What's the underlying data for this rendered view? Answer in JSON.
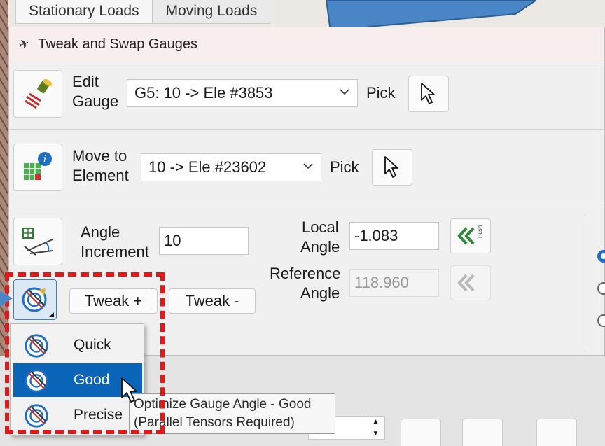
{
  "background": {
    "tabs": [
      "Stationary Loads",
      "Moving Loads"
    ]
  },
  "dialog": {
    "title": "Tweak and Swap Gauges",
    "edit_gauge": {
      "label_line1": "Edit",
      "label_line2": "Gauge",
      "value": "G5: 10 -> Ele #3853",
      "pick_label": "Pick"
    },
    "move_to_element": {
      "label_line1": "Move to",
      "label_line2": "Element",
      "value": "10 -> Ele #23602",
      "pick_label": "Pick"
    },
    "angle": {
      "increment_label_line1": "Angle",
      "increment_label_line2": "Increment",
      "increment_value": "10",
      "local_label_line1": "Local",
      "local_label_line2": "Angle",
      "local_value": "-1.083",
      "reference_label_line1": "Reference",
      "reference_label_line2": "Angle",
      "reference_value": "118.960",
      "push_text": "Push"
    },
    "tweak_plus_label": "Tweak +",
    "tweak_minus_label": "Tweak -"
  },
  "optimize_menu": {
    "items": [
      {
        "label": "Quick"
      },
      {
        "label": "Good"
      },
      {
        "label": "Precise"
      }
    ],
    "selected": "Good"
  },
  "tooltip": {
    "line1": "Optimize Gauge Angle - Good",
    "line2": "(Parallel Tensors Required)"
  },
  "colors": {
    "accent": "#0a64b8",
    "highlight_dash": "#e01919",
    "callout": "#3f7fbf"
  }
}
